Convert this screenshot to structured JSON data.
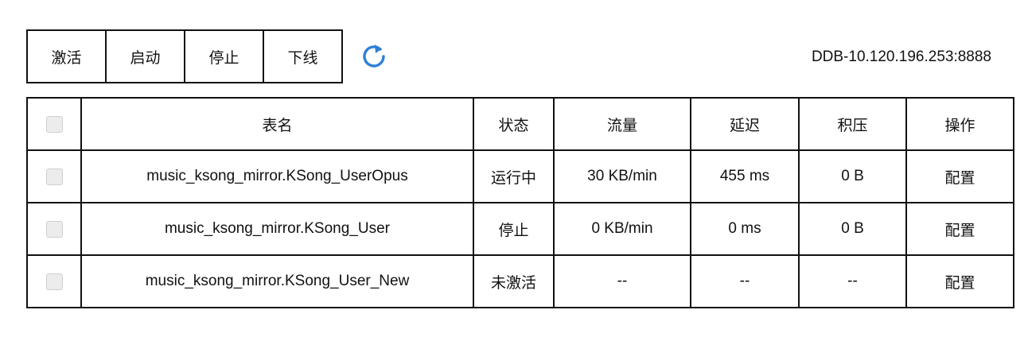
{
  "toolbar": {
    "buttons": [
      "激活",
      "启动",
      "停止",
      "下线"
    ],
    "refresh_icon": "refresh-icon",
    "refresh_color": "#2f7fd6"
  },
  "server_label": "DDB-10.120.196.253:8888",
  "table": {
    "headers": [
      "表名",
      "状态",
      "流量",
      "延迟",
      "积压",
      "操作"
    ],
    "rows": [
      {
        "name": "music_ksong_mirror.KSong_UserOpus",
        "status": "运行中",
        "traffic": "30 KB/min",
        "latency": "455 ms",
        "backlog": "0 B",
        "action": "配置"
      },
      {
        "name": "music_ksong_mirror.KSong_User",
        "status": "停止",
        "traffic": "0 KB/min",
        "latency": "0 ms",
        "backlog": "0 B",
        "action": "配置"
      },
      {
        "name": "music_ksong_mirror.KSong_User_New",
        "status": "未激活",
        "traffic": "--",
        "latency": "--",
        "backlog": "--",
        "action": "配置"
      }
    ]
  }
}
